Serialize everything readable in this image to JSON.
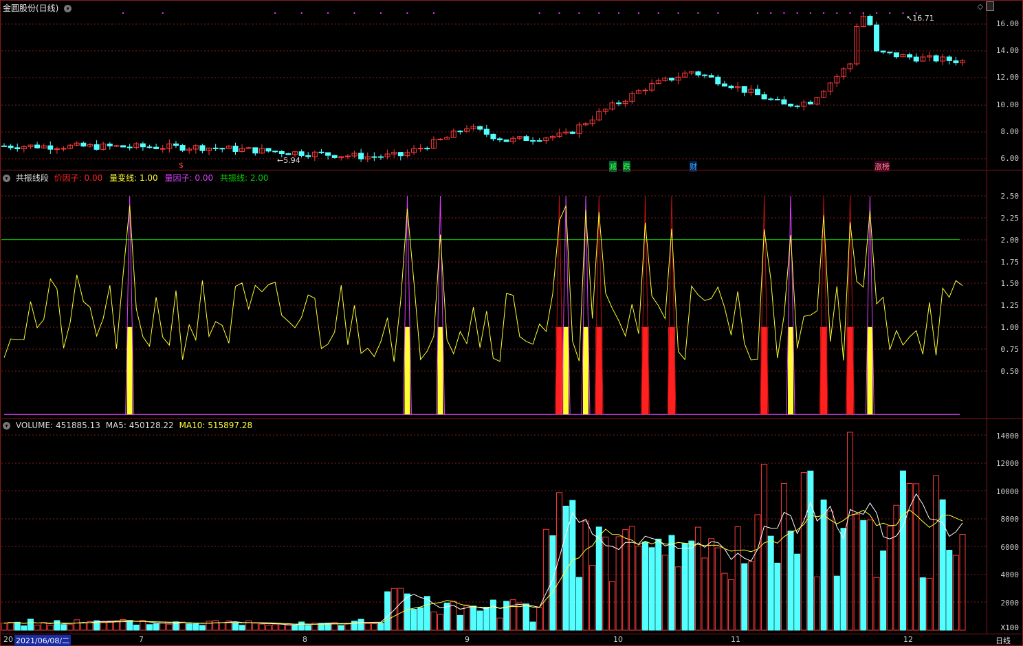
{
  "title_bar": {
    "stock": "金圆股份(日线)"
  },
  "price_axis": [
    "16.00",
    "14.00",
    "12.00",
    "10.00",
    "8.00",
    "6.00"
  ],
  "price_marks": {
    "high": "16.71",
    "low": "5.94"
  },
  "event_tags": [
    {
      "text": "$",
      "color": "#ff4040"
    },
    {
      "text": "减",
      "color": "#40ff40"
    },
    {
      "text": "跌",
      "color": "#40ff40"
    },
    {
      "text": "财",
      "color": "#40a0ff"
    },
    {
      "text": "涨榜",
      "color": "#ff9090"
    }
  ],
  "indicator": {
    "name": "共振线段",
    "f1_label": "价因子:",
    "f1_value": "0.00",
    "f2_label": "量变线:",
    "f2_value": "1.00",
    "f3_label": "量因子:",
    "f3_value": "0.00",
    "f4_label": "共振线:",
    "f4_value": "2.00",
    "axis": [
      "2.50",
      "2.25",
      "2.00",
      "1.75",
      "1.50",
      "1.25",
      "1.00",
      "0.75",
      "0.50"
    ]
  },
  "volume": {
    "label": "VOLUME:",
    "value": "451885.13",
    "ma5_label": "MA5:",
    "ma5": "450128.22",
    "ma10_label": "MA10:",
    "ma10": "515897.28",
    "axis": [
      "14000",
      "12000",
      "10000",
      "8000",
      "6000",
      "4000",
      "2000"
    ],
    "unit": "X100"
  },
  "time_axis": {
    "year_prefix": "20",
    "cursor_date": "2021/06/08/二",
    "months": [
      "7",
      "8",
      "9",
      "10",
      "11",
      "12"
    ],
    "period": "日线"
  },
  "colors": {
    "up": "#ff3b3b",
    "down": "#54ffff",
    "grid": "#8b1a1a",
    "vol_ma5": "#ffffff",
    "vol_ma10": "#ffff40",
    "resonance": "#00c000",
    "price_factor": "#ff2020",
    "vol_change": "#ffff30",
    "vol_factor": "#e040ff"
  }
}
